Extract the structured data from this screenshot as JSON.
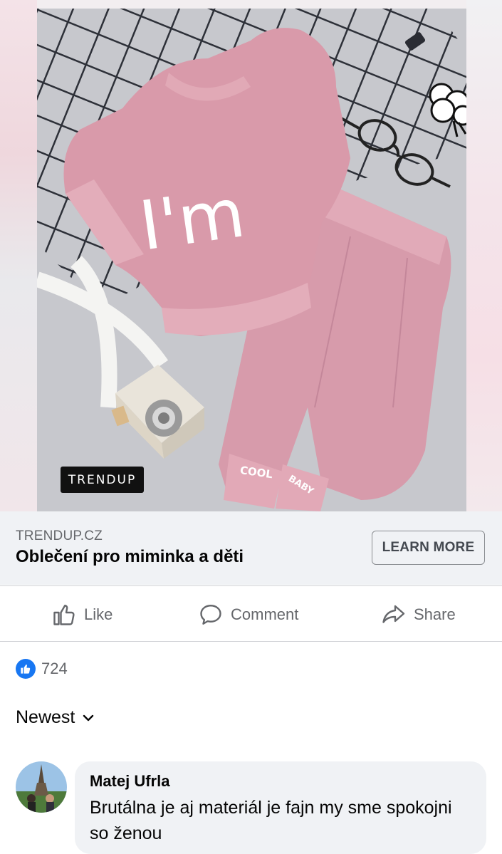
{
  "ad": {
    "brand_logo_text": "TRENDUP",
    "garment_text": "I'm",
    "cuff_text_left": "COOL",
    "cuff_text_right": "BABY",
    "domain": "TRENDUP.CZ",
    "title": "Oblečení pro miminka a děti",
    "cta_label": "LEARN MORE"
  },
  "actions": {
    "like_label": "Like",
    "comment_label": "Comment",
    "share_label": "Share"
  },
  "reactions": {
    "count": "724",
    "icon": "thumbs-up-icon"
  },
  "sort": {
    "label": "Newest",
    "icon": "chevron-down-icon"
  },
  "comments": [
    {
      "author": "Matej Ufrla",
      "text": "Brutálna je aj materiál je fajn my sme spokojni so ženou"
    }
  ],
  "colors": {
    "accent": "#1877f2",
    "secondary_text": "#65676b",
    "surface": "#f0f2f5",
    "garment_pink": "#d99aaa"
  }
}
